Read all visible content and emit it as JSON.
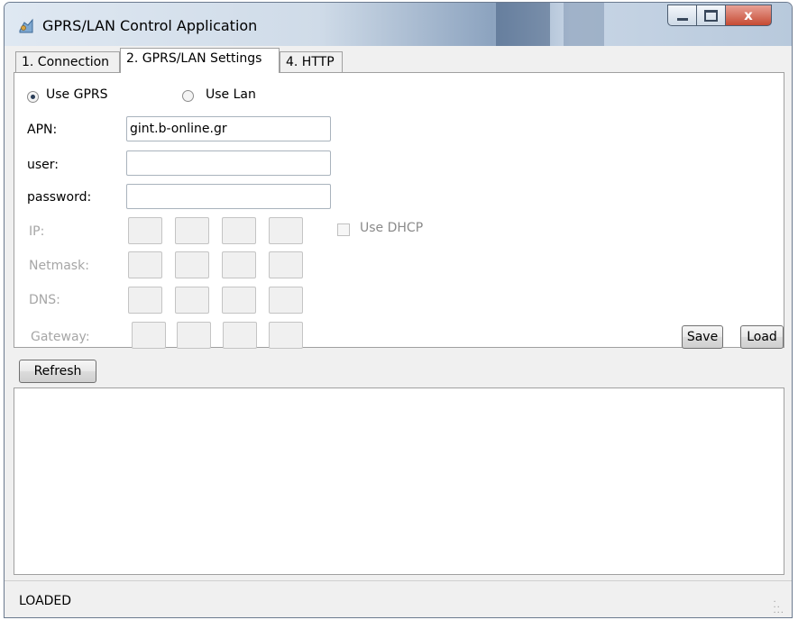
{
  "window": {
    "title": "GPRS/LAN Control Application",
    "controls": {
      "minimize": "",
      "maximize": "",
      "close": "x"
    }
  },
  "tabs": [
    {
      "label": "1. Connection",
      "active": false
    },
    {
      "label": "2. GPRS/LAN Settings",
      "active": true
    },
    {
      "label": "4. HTTP",
      "active": false
    }
  ],
  "mode": {
    "gprs_label": "Use GPRS",
    "lan_label": "Use Lan",
    "selected": "gprs"
  },
  "fields": {
    "apn_label": "APN:",
    "apn_value": "gint.b-online.gr",
    "user_label": "user:",
    "user_value": "",
    "password_label": "password:",
    "password_value": ""
  },
  "network": {
    "ip_label": "IP:",
    "netmask_label": "Netmask:",
    "dns_label": "DNS:",
    "gateway_label": "Gateway:",
    "dhcp_label": "Use DHCP",
    "dhcp_checked": false
  },
  "buttons": {
    "save": "Save",
    "load": "Load",
    "refresh": "Refresh"
  },
  "output_text": "",
  "status": {
    "text": "LOADED"
  },
  "icons": {
    "app": "app-icon",
    "grip": "resize-grip-icon"
  }
}
